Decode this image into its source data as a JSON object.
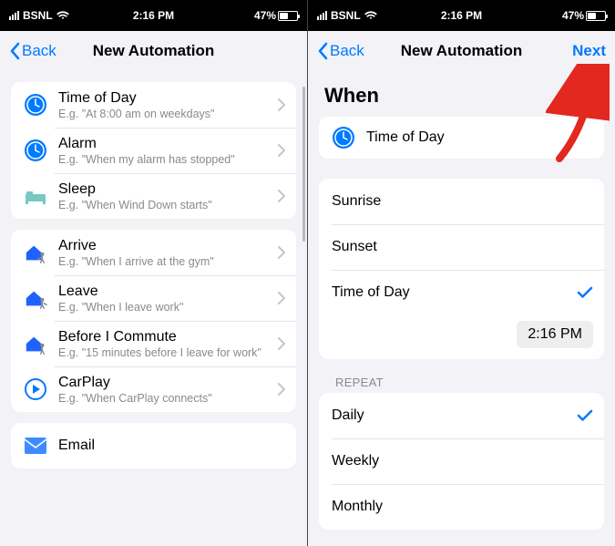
{
  "status": {
    "carrier": "BSNL",
    "time": "2:16 PM",
    "battery_pct": "47%"
  },
  "left": {
    "back_label": "Back",
    "title": "New Automation",
    "groups": [
      {
        "rows": [
          {
            "icon": "clock-icon",
            "title": "Time of Day",
            "subtitle": "E.g. \"At 8:00 am on weekdays\""
          },
          {
            "icon": "clock-icon",
            "title": "Alarm",
            "subtitle": "E.g. \"When my alarm has stopped\""
          },
          {
            "icon": "bed-icon",
            "title": "Sleep",
            "subtitle": "E.g. \"When Wind Down starts\""
          }
        ]
      },
      {
        "rows": [
          {
            "icon": "home-arrive-icon",
            "title": "Arrive",
            "subtitle": "E.g. \"When I arrive at the gym\""
          },
          {
            "icon": "home-leave-icon",
            "title": "Leave",
            "subtitle": "E.g. \"When I leave work\""
          },
          {
            "icon": "home-commute-icon",
            "title": "Before I Commute",
            "subtitle": "E.g. \"15 minutes before I leave for work\""
          },
          {
            "icon": "carplay-icon",
            "title": "CarPlay",
            "subtitle": "E.g. \"When CarPlay connects\""
          }
        ]
      },
      {
        "rows": [
          {
            "icon": "mail-icon",
            "title": "Email",
            "subtitle": ""
          }
        ]
      }
    ]
  },
  "right": {
    "back_label": "Back",
    "title": "New Automation",
    "next_label": "Next",
    "when_header": "When",
    "selected_trigger": "Time of Day",
    "sun_options": [
      {
        "label": "Sunrise",
        "checked": false
      },
      {
        "label": "Sunset",
        "checked": false
      },
      {
        "label": "Time of Day",
        "checked": true
      }
    ],
    "time_value": "2:16 PM",
    "repeat_label": "REPEAT",
    "repeat_options": [
      {
        "label": "Daily",
        "checked": true
      },
      {
        "label": "Weekly",
        "checked": false
      },
      {
        "label": "Monthly",
        "checked": false
      }
    ]
  },
  "colors": {
    "accent": "#007aff",
    "house": "#1e62ff",
    "gray": "#8a8a8e",
    "red": "#e2281f"
  }
}
